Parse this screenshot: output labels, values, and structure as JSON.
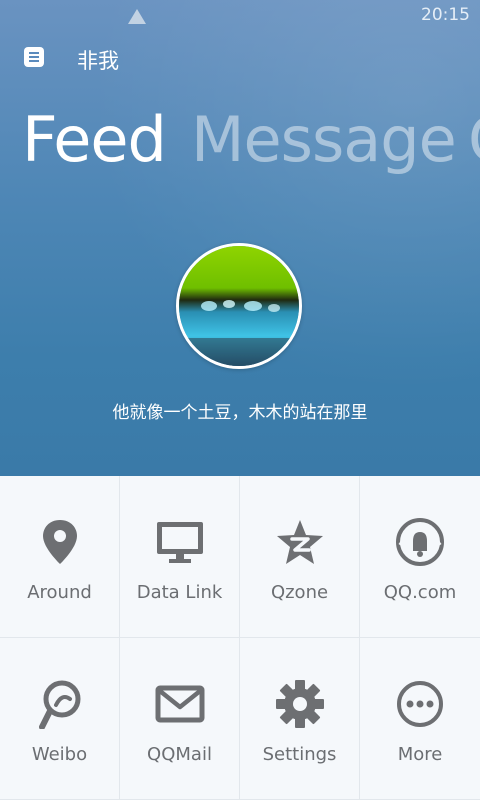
{
  "status_bar": {
    "time": "20:15"
  },
  "header": {
    "username": "非我"
  },
  "tabs": [
    "Feed",
    "Message",
    "C"
  ],
  "profile": {
    "signature": "他就像一个土豆，木木的站在那里"
  },
  "grid": [
    {
      "label": "Around",
      "icon": "location-pin-icon"
    },
    {
      "label": "Data Link",
      "icon": "monitor-icon"
    },
    {
      "label": "Qzone",
      "icon": "qzone-star-icon"
    },
    {
      "label": "QQ.com",
      "icon": "qq-com-icon"
    },
    {
      "label": "Weibo",
      "icon": "weibo-icon"
    },
    {
      "label": "QQMail",
      "icon": "mail-icon"
    },
    {
      "label": "Settings",
      "icon": "gear-icon"
    },
    {
      "label": "More",
      "icon": "more-dots-icon"
    }
  ],
  "colors": {
    "icon_gray": "#6d6f72",
    "hero_blue": "#4a86b5"
  }
}
